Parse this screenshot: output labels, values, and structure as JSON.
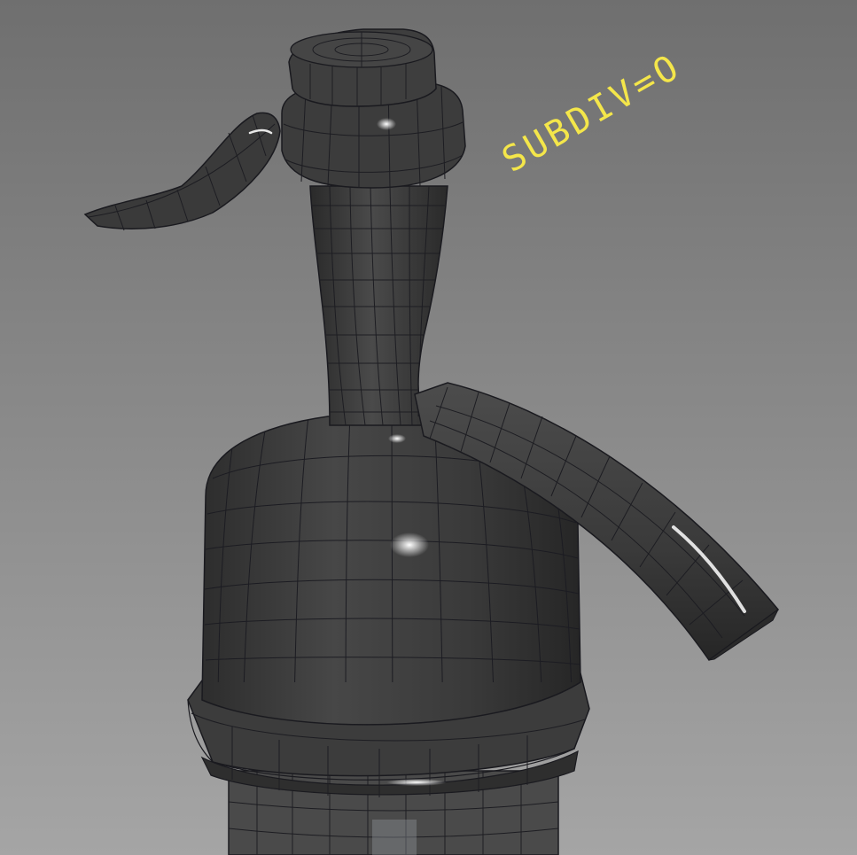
{
  "viewport": {
    "background_top": "#707070",
    "background_bottom": "#a2a2a2",
    "mesh_color": "#3c3c3c",
    "wire_color": "#1a1a1f",
    "highlight_color": "#ffffff"
  },
  "annotation": {
    "text": "SUBDIV=O",
    "color": "#f4e64a"
  }
}
